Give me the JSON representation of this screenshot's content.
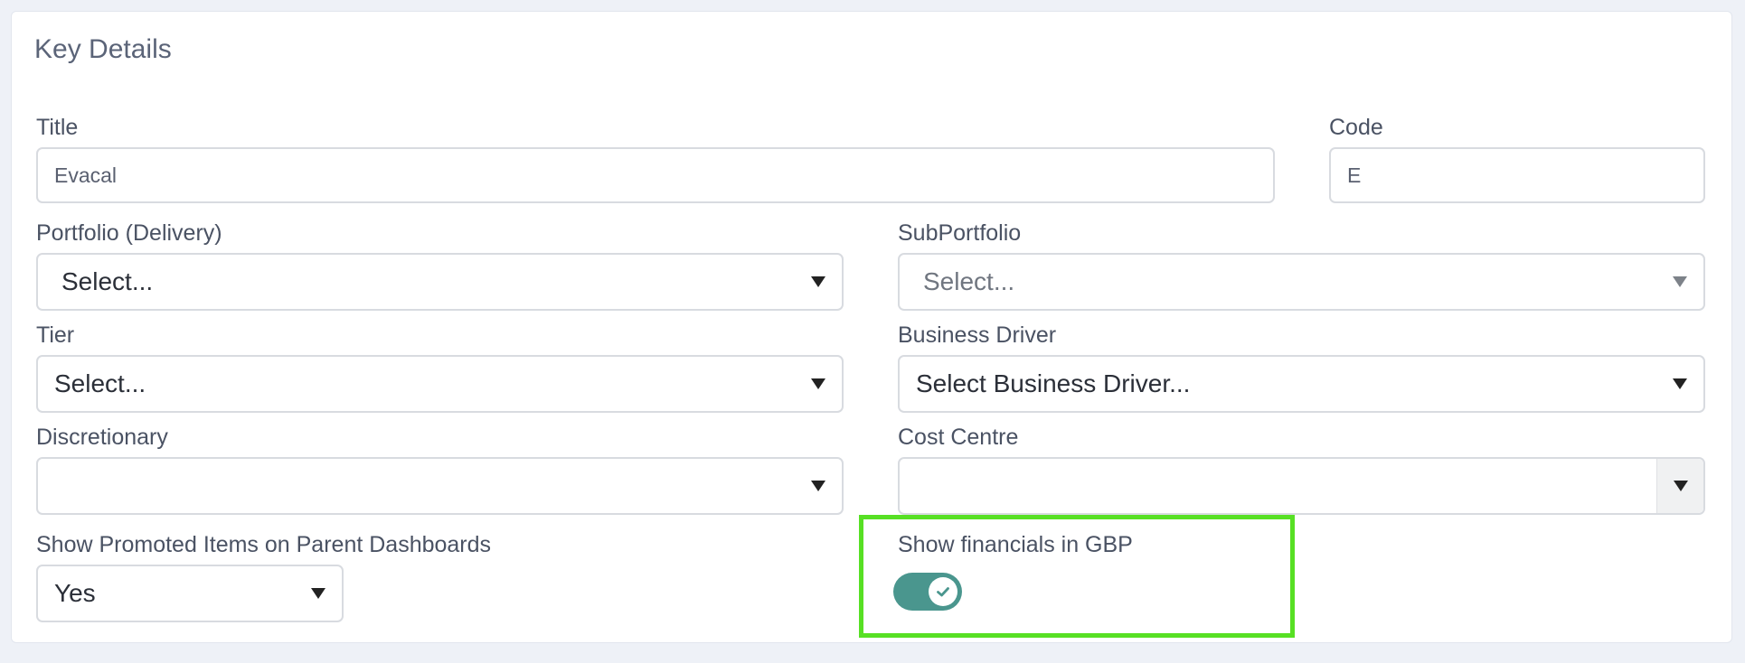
{
  "section": {
    "title": "Key Details"
  },
  "fields": {
    "title": {
      "label": "Title",
      "value": "Evacal"
    },
    "code": {
      "label": "Code",
      "value": "E"
    },
    "portfolio": {
      "label": "Portfolio (Delivery)",
      "value": "Select..."
    },
    "subportfolio": {
      "label": "SubPortfolio",
      "value": "Select..."
    },
    "tier": {
      "label": "Tier",
      "value": "Select..."
    },
    "business_driver": {
      "label": "Business Driver",
      "value": "Select Business Driver..."
    },
    "discretionary": {
      "label": "Discretionary",
      "value": ""
    },
    "cost_centre": {
      "label": "Cost Centre",
      "value": ""
    },
    "show_promoted": {
      "label": "Show Promoted Items on Parent Dashboards",
      "value": "Yes"
    },
    "show_financials": {
      "label": "Show financials in GBP",
      "checked": true
    }
  },
  "colors": {
    "toggle_on": "#4a968e",
    "highlight": "#57e024",
    "page_background": "#eef1f7"
  },
  "icons": {
    "dropdown": "caret-down-icon",
    "toggle_check": "check-icon"
  }
}
